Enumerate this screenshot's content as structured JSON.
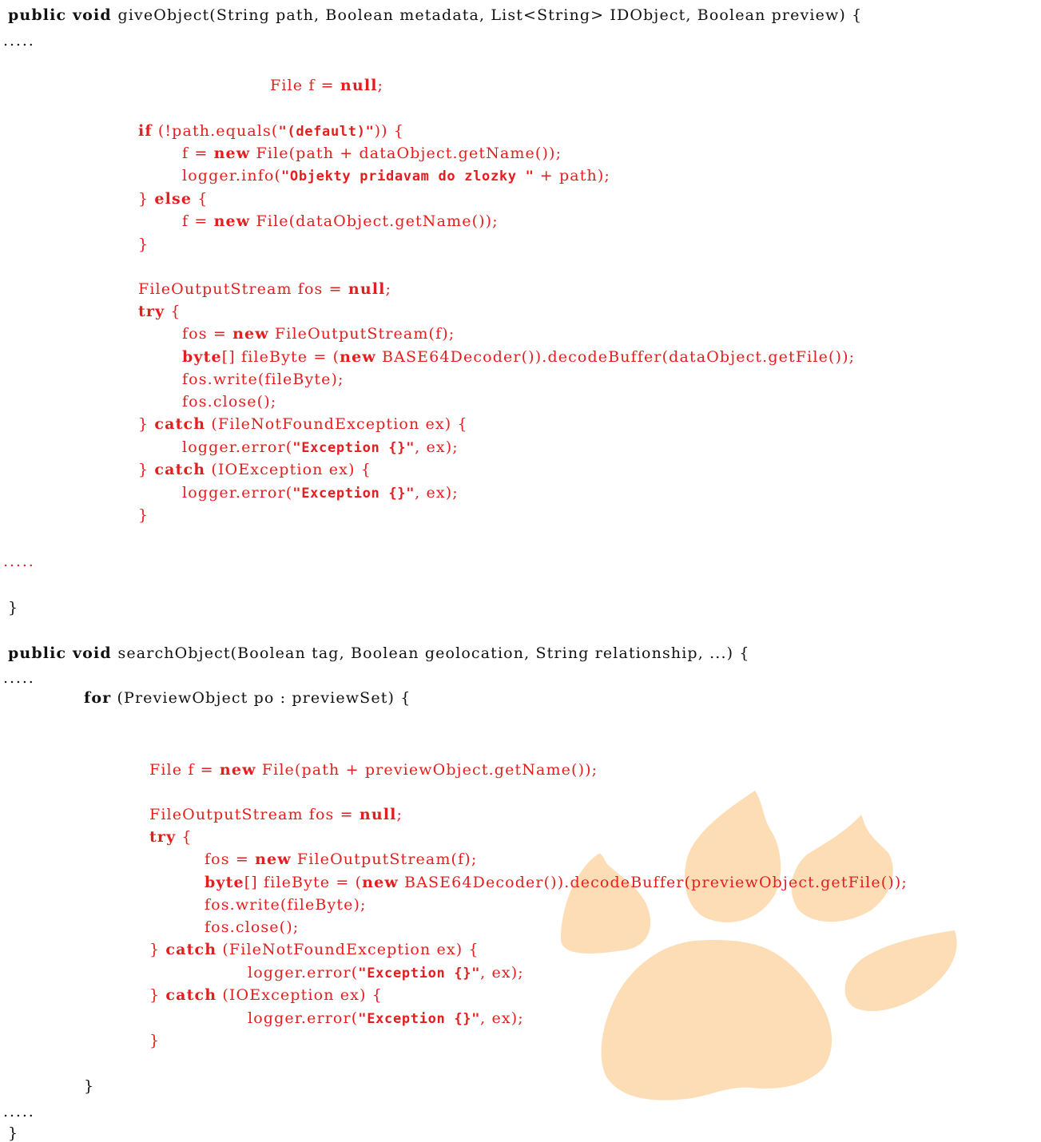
{
  "colors": {
    "added_code": "#e41e1e",
    "original_code": "#111111",
    "paw_print": "#fdddb5",
    "background": "#ffffff"
  },
  "icons": [
    "paw-print-icon"
  ],
  "code_lines": [
    [
      {
        "t": "public void ",
        "s": "kw"
      },
      {
        "t": "giveObject(String path, Boolean metadata, List<String> IDObject, Boolean preview) {",
        "s": "id"
      }
    ],
    [
      {
        "t": ".....",
        "s": "dots"
      }
    ],
    [
      {
        "t": "File f = ",
        "s": "r"
      },
      {
        "t": "null",
        "s": "rkw"
      },
      {
        "t": ";",
        "s": "r"
      }
    ],
    [
      {
        "t": "if",
        "s": "rkw"
      },
      {
        "t": " (!path.equals(",
        "s": "r"
      },
      {
        "t": "\"(default)\"",
        "s": "rstr"
      },
      {
        "t": ")) {",
        "s": "r"
      }
    ],
    [
      {
        "t": "f = ",
        "s": "r"
      },
      {
        "t": "new",
        "s": "rkw"
      },
      {
        "t": " File(path + dataObject.getName());",
        "s": "r"
      }
    ],
    [
      {
        "t": "logger.info(",
        "s": "r"
      },
      {
        "t": "\"Objekty pridavam do zlozky \"",
        "s": "rstr"
      },
      {
        "t": " + path);",
        "s": "r"
      }
    ],
    [
      {
        "t": "} ",
        "s": "r"
      },
      {
        "t": "else",
        "s": "rkw"
      },
      {
        "t": " {",
        "s": "r"
      }
    ],
    [
      {
        "t": "f = ",
        "s": "r"
      },
      {
        "t": "new",
        "s": "rkw"
      },
      {
        "t": " File(dataObject.getName());",
        "s": "r"
      }
    ],
    [
      {
        "t": "}",
        "s": "r"
      }
    ],
    [
      {
        "t": "FileOutputStream fos = ",
        "s": "r"
      },
      {
        "t": "null",
        "s": "rkw"
      },
      {
        "t": ";",
        "s": "r"
      }
    ],
    [
      {
        "t": "try",
        "s": "rkw"
      },
      {
        "t": " {",
        "s": "r"
      }
    ],
    [
      {
        "t": "fos = ",
        "s": "r"
      },
      {
        "t": "new",
        "s": "rkw"
      },
      {
        "t": " FileOutputStream(f);",
        "s": "r"
      }
    ],
    [
      {
        "t": "byte",
        "s": "rkw"
      },
      {
        "t": "[] fileByte = (",
        "s": "r"
      },
      {
        "t": "new",
        "s": "rkw"
      },
      {
        "t": " BASE64Decoder()).decodeBuffer(dataObject.getFile());",
        "s": "r"
      }
    ],
    [
      {
        "t": "fos.write(fileByte);",
        "s": "r"
      }
    ],
    [
      {
        "t": "fos.close();",
        "s": "r"
      }
    ],
    [
      {
        "t": "} ",
        "s": "r"
      },
      {
        "t": "catch",
        "s": "rkw"
      },
      {
        "t": " (FileNotFoundException ex) {",
        "s": "r"
      }
    ],
    [
      {
        "t": "logger.error(",
        "s": "r"
      },
      {
        "t": "\"Exception {}\"",
        "s": "rstr"
      },
      {
        "t": ", ex);",
        "s": "r"
      }
    ],
    [
      {
        "t": "} ",
        "s": "r"
      },
      {
        "t": "catch",
        "s": "rkw"
      },
      {
        "t": " (IOException ex) {",
        "s": "r"
      }
    ],
    [
      {
        "t": "logger.error(",
        "s": "r"
      },
      {
        "t": "\"Exception {}\"",
        "s": "rstr"
      },
      {
        "t": ", ex);",
        "s": "r"
      }
    ],
    [
      {
        "t": "}",
        "s": "r"
      }
    ],
    [
      {
        "t": ".....",
        "s": "rdots"
      }
    ],
    [
      {
        "t": "}",
        "s": "id"
      }
    ],
    [
      {
        "t": "public void ",
        "s": "kw"
      },
      {
        "t": "searchObject(Boolean tag, Boolean geolocation, String relationship, ...) {",
        "s": "id"
      }
    ],
    [
      {
        "t": ".....",
        "s": "dots"
      }
    ],
    [
      {
        "t": "for",
        "s": "kw"
      },
      {
        "t": " (PreviewObject po : previewSet) {",
        "s": "id"
      }
    ],
    [
      {
        "t": "File f = ",
        "s": "r"
      },
      {
        "t": "new",
        "s": "rkw"
      },
      {
        "t": " File(path + previewObject.getName());",
        "s": "r"
      }
    ],
    [
      {
        "t": "FileOutputStream fos = ",
        "s": "r"
      },
      {
        "t": "null",
        "s": "rkw"
      },
      {
        "t": ";",
        "s": "r"
      }
    ],
    [
      {
        "t": "try",
        "s": "rkw"
      },
      {
        "t": " {",
        "s": "r"
      }
    ],
    [
      {
        "t": "fos = ",
        "s": "r"
      },
      {
        "t": "new",
        "s": "rkw"
      },
      {
        "t": " FileOutputStream(f);",
        "s": "r"
      }
    ],
    [
      {
        "t": "byte",
        "s": "rkw"
      },
      {
        "t": "[] fileByte = (",
        "s": "r"
      },
      {
        "t": "new",
        "s": "rkw"
      },
      {
        "t": " BASE64Decoder()).decodeBuffer(previewObject.getFile());",
        "s": "r"
      }
    ],
    [
      {
        "t": "fos.write(fileByte);",
        "s": "r"
      }
    ],
    [
      {
        "t": "fos.close();",
        "s": "r"
      }
    ],
    [
      {
        "t": "} ",
        "s": "r"
      },
      {
        "t": "catch",
        "s": "rkw"
      },
      {
        "t": " (FileNotFoundException ex) {",
        "s": "r"
      }
    ],
    [
      {
        "t": "logger.error(",
        "s": "r"
      },
      {
        "t": "\"Exception {}\"",
        "s": "rstr"
      },
      {
        "t": ", ex);",
        "s": "r"
      }
    ],
    [
      {
        "t": "} ",
        "s": "r"
      },
      {
        "t": "catch",
        "s": "rkw"
      },
      {
        "t": " (IOException ex) {",
        "s": "r"
      }
    ],
    [
      {
        "t": "logger.error(",
        "s": "r"
      },
      {
        "t": "\"Exception {}\"",
        "s": "rstr"
      },
      {
        "t": ", ex);",
        "s": "r"
      }
    ],
    [
      {
        "t": "}",
        "s": "r"
      }
    ],
    [
      {
        "t": "}",
        "s": "id"
      }
    ],
    [
      {
        "t": ".....",
        "s": "dots"
      }
    ],
    [
      {
        "t": "}",
        "s": "id"
      }
    ]
  ]
}
